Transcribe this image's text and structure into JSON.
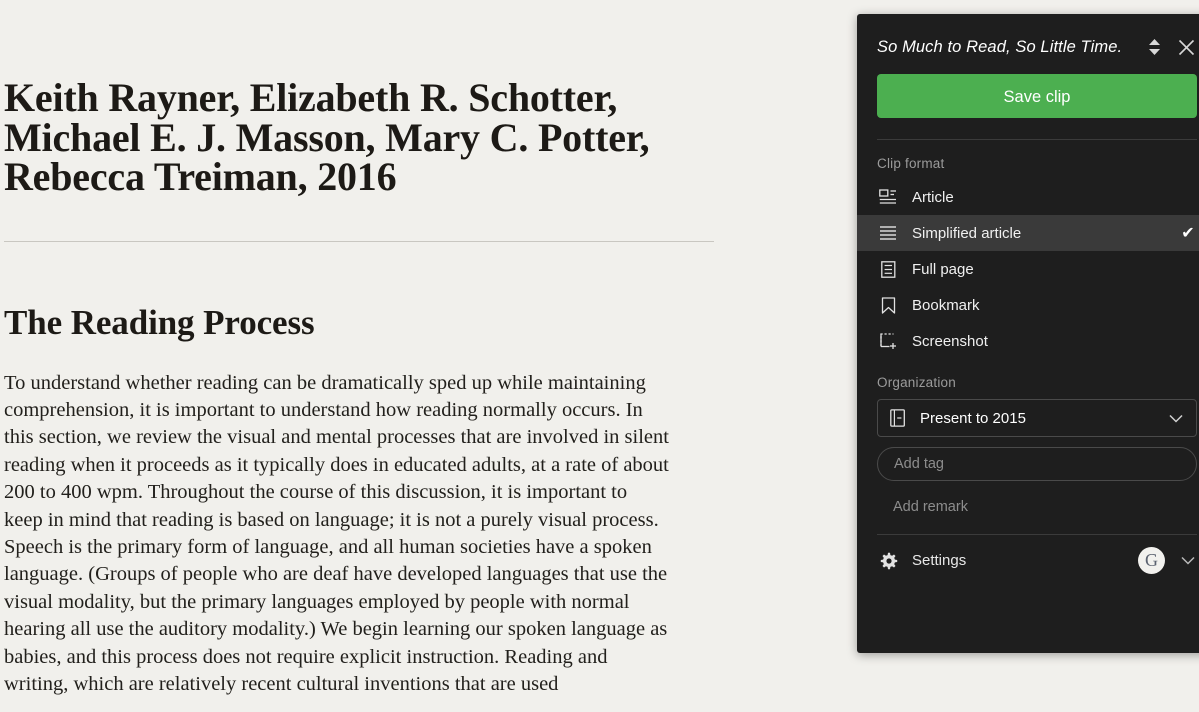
{
  "article": {
    "byline": "Keith Rayner, Elizabeth R. Schotter,\nMichael E. J. Masson, Mary C. Potter,\nRebecca Treiman, 2016",
    "section_heading": "The Reading Process",
    "paragraph": "To understand whether reading can be dramatically sped up while maintaining comprehension, it is important to understand how reading normally occurs. In this section, we review the visual and mental processes that are involved in silent reading when it proceeds as it typically does in educated adults, at a rate of about 200 to 400 wpm. Throughout the course of this discussion, it is important to keep in mind that reading is based on language; it is not a purely visual process. Speech is the primary form of language, and all human societies have a spoken language. (Groups of people who are deaf have developed languages that use the visual modality, but the primary languages employed by people with normal hearing all use the auditory modality.) We begin learning our spoken language as babies, and this process does not require explicit instruction. Reading and writing, which are relatively recent cultural inventions that are used"
  },
  "clipper": {
    "title": "So Much to Read, So Little Time.",
    "resize_icon": "resize-handle-icon",
    "close_icon": "close-icon",
    "save_label": "Save clip",
    "save_color": "#4caf50",
    "clip_format": {
      "label": "Clip format",
      "selected": "Simplified article",
      "check_glyph": "✔",
      "options": [
        {
          "label": "Article",
          "icon": "article-icon",
          "selected": false
        },
        {
          "label": "Simplified article",
          "icon": "simplified-article-icon",
          "selected": true
        },
        {
          "label": "Full page",
          "icon": "full-page-icon",
          "selected": false
        },
        {
          "label": "Bookmark",
          "icon": "bookmark-icon",
          "selected": false
        },
        {
          "label": "Screenshot",
          "icon": "screenshot-icon",
          "selected": false
        }
      ]
    },
    "organization": {
      "label": "Organization",
      "notebook_value": "Present to 2015",
      "notebook_icon": "notebook-icon",
      "chevron_icon": "chevron-down-icon",
      "tag_placeholder": "Add tag",
      "tag_value": "",
      "remark_label": "Add remark"
    },
    "footer": {
      "settings_label": "Settings",
      "gear_icon": "gear-icon",
      "avatar_initial": "G",
      "caret_icon": "chevron-down-icon"
    }
  }
}
